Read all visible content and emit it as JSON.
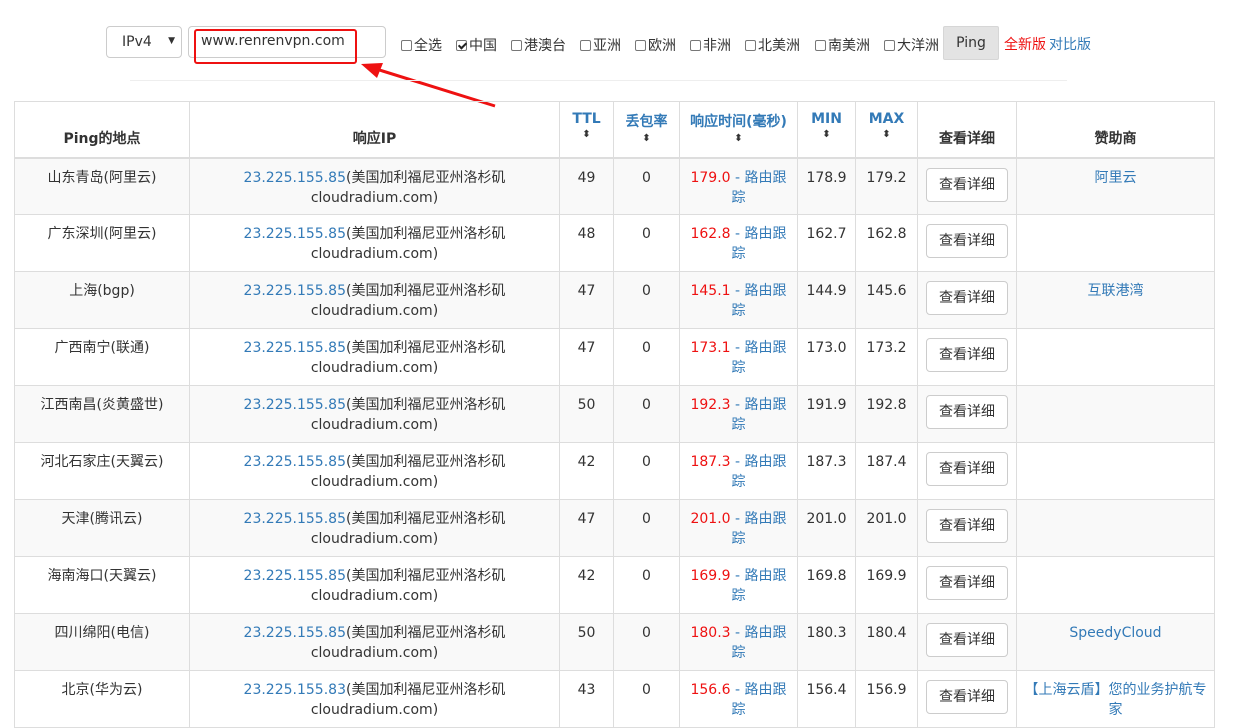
{
  "toolbar": {
    "ip_version": "IPv4",
    "url_value": "www.renrenvpn.com",
    "regions": [
      {
        "label": "全选",
        "checked": false
      },
      {
        "label": "中国",
        "checked": true
      },
      {
        "label": "港澳台",
        "checked": false
      },
      {
        "label": "亚洲",
        "checked": false
      },
      {
        "label": "欧洲",
        "checked": false
      },
      {
        "label": "非洲",
        "checked": false
      },
      {
        "label": "北美洲",
        "checked": false
      },
      {
        "label": "南美洲",
        "checked": false
      },
      {
        "label": "大洋洲",
        "checked": false
      }
    ],
    "ping_label": "Ping",
    "full_version_label": "全新版",
    "compare_label": "对比版"
  },
  "table": {
    "headers": {
      "location": "Ping的地点",
      "ip": "响应IP",
      "ttl": "TTL",
      "loss": "丢包率",
      "time": "响应时间(毫秒)",
      "min": "MIN",
      "max": "MAX",
      "detail": "查看详细",
      "sponsor": "赞助商"
    },
    "sort_icon": "⬍",
    "trace_label": "路由跟踪",
    "detail_label": "查看详细",
    "rows": [
      {
        "location": "山东青岛(阿里云)",
        "ip": "23.225.155.85",
        "ip_info": "(美国加利福尼亚州洛杉矶",
        "host": "cloudradium.com)",
        "ttl": "49",
        "loss": "0",
        "time": "179.0",
        "min": "178.9",
        "max": "179.2",
        "sponsor": "阿里云"
      },
      {
        "location": "广东深圳(阿里云)",
        "ip": "23.225.155.85",
        "ip_info": "(美国加利福尼亚州洛杉矶",
        "host": "cloudradium.com)",
        "ttl": "48",
        "loss": "0",
        "time": "162.8",
        "min": "162.7",
        "max": "162.8",
        "sponsor": ""
      },
      {
        "location": "上海(bgp)",
        "ip": "23.225.155.85",
        "ip_info": "(美国加利福尼亚州洛杉矶",
        "host": "cloudradium.com)",
        "ttl": "47",
        "loss": "0",
        "time": "145.1",
        "min": "144.9",
        "max": "145.6",
        "sponsor": "互联港湾"
      },
      {
        "location": "广西南宁(联通)",
        "ip": "23.225.155.85",
        "ip_info": "(美国加利福尼亚州洛杉矶",
        "host": "cloudradium.com)",
        "ttl": "47",
        "loss": "0",
        "time": "173.1",
        "min": "173.0",
        "max": "173.2",
        "sponsor": ""
      },
      {
        "location": "江西南昌(炎黄盛世)",
        "ip": "23.225.155.85",
        "ip_info": "(美国加利福尼亚州洛杉矶",
        "host": "cloudradium.com)",
        "ttl": "50",
        "loss": "0",
        "time": "192.3",
        "min": "191.9",
        "max": "192.8",
        "sponsor": ""
      },
      {
        "location": "河北石家庄(天翼云)",
        "ip": "23.225.155.85",
        "ip_info": "(美国加利福尼亚州洛杉矶",
        "host": "cloudradium.com)",
        "ttl": "42",
        "loss": "0",
        "time": "187.3",
        "min": "187.3",
        "max": "187.4",
        "sponsor": ""
      },
      {
        "location": "天津(腾讯云)",
        "ip": "23.225.155.85",
        "ip_info": "(美国加利福尼亚州洛杉矶",
        "host": "cloudradium.com)",
        "ttl": "47",
        "loss": "0",
        "time": "201.0",
        "min": "201.0",
        "max": "201.0",
        "sponsor": ""
      },
      {
        "location": "海南海口(天翼云)",
        "ip": "23.225.155.85",
        "ip_info": "(美国加利福尼亚州洛杉矶",
        "host": "cloudradium.com)",
        "ttl": "42",
        "loss": "0",
        "time": "169.9",
        "min": "169.8",
        "max": "169.9",
        "sponsor": ""
      },
      {
        "location": "四川绵阳(电信)",
        "ip": "23.225.155.85",
        "ip_info": "(美国加利福尼亚州洛杉矶",
        "host": "cloudradium.com)",
        "ttl": "50",
        "loss": "0",
        "time": "180.3",
        "min": "180.3",
        "max": "180.4",
        "sponsor": "SpeedyCloud"
      },
      {
        "location": "北京(华为云)",
        "ip": "23.225.155.83",
        "ip_info": "(美国加利福尼亚州洛杉矶",
        "host": "cloudradium.com)",
        "ttl": "43",
        "loss": "0",
        "time": "156.6",
        "min": "156.4",
        "max": "156.9",
        "sponsor": "【上海云盾】您的业务护航专家"
      }
    ]
  }
}
